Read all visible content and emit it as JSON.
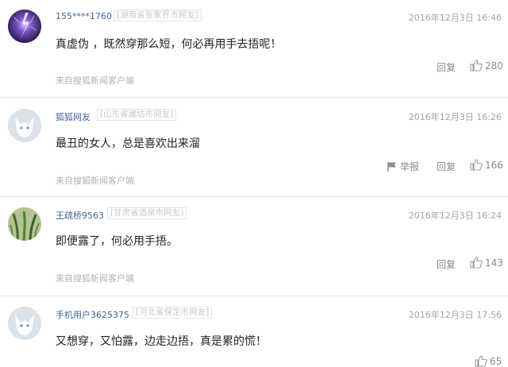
{
  "comments": [
    {
      "user": "155****1760",
      "location": "[湖南省张家界市网友]",
      "time": "2016年12月3日 16:46",
      "text": "真虚伪 ，既然穿那么短，何必再用手去捂呢！",
      "source": "来自搜狐新闻客户端",
      "reply_label": "回复",
      "likes": "280",
      "avatar": "purple-lightning"
    },
    {
      "user": "狐狐网友",
      "location": "[山东省潍坊市网友]",
      "time": "2016年12月3日 16:26",
      "text": "最丑的女人，总是喜欢出来溜",
      "source": "来自搜狐新闻客户端",
      "report_label": "举报",
      "reply_label": "回复",
      "likes": "166",
      "avatar": "default-fox"
    },
    {
      "user": "王疏桥9563",
      "location": "[甘肃省酒泉市网友]",
      "time": "2016年12月3日 16:24",
      "text": "即便露了，何必用手捂。",
      "source": "来自搜狐新闻客户端",
      "reply_label": "回复",
      "likes": "143",
      "avatar": "green-plant"
    },
    {
      "user": "手机用户3625375",
      "location": "[河北省保定市网友]",
      "time": "2016年12月3日 17:56",
      "text": "又想穿，又怕露，边走边捂，真是累的慌！",
      "likes": "65",
      "avatar": "default-fox"
    }
  ],
  "colors": {
    "username": "#406599",
    "meta": "#a3a3a3",
    "divider": "#e8e8e8"
  }
}
